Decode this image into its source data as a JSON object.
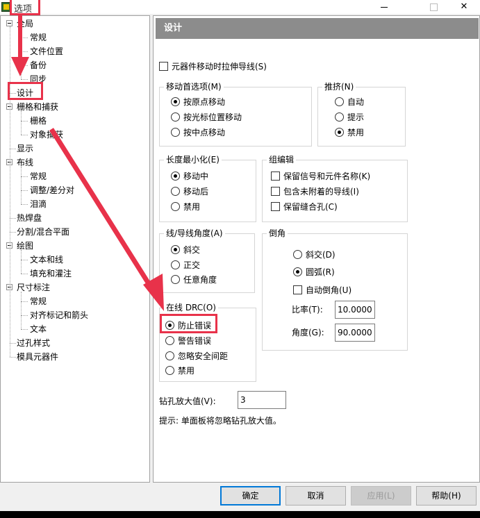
{
  "window": {
    "title": "选项"
  },
  "tree": [
    {
      "label": "全局",
      "level": 0,
      "expandable": true
    },
    {
      "label": "常规",
      "level": 1
    },
    {
      "label": "文件位置",
      "level": 1
    },
    {
      "label": "备份",
      "level": 1
    },
    {
      "label": "同步",
      "level": 1
    },
    {
      "label": "设计",
      "level": 0,
      "selected": true
    },
    {
      "label": "栅格和捕获",
      "level": 0,
      "expandable": true
    },
    {
      "label": "栅格",
      "level": 1
    },
    {
      "label": "对象捕获",
      "level": 1
    },
    {
      "label": "显示",
      "level": 0
    },
    {
      "label": "布线",
      "level": 0,
      "expandable": true
    },
    {
      "label": "常规",
      "level": 1
    },
    {
      "label": "调整/差分对",
      "level": 1
    },
    {
      "label": "泪滴",
      "level": 1
    },
    {
      "label": "热焊盘",
      "level": 0
    },
    {
      "label": "分割/混合平面",
      "level": 0
    },
    {
      "label": "绘图",
      "level": 0,
      "expandable": true
    },
    {
      "label": "文本和线",
      "level": 1
    },
    {
      "label": "填充和灌注",
      "level": 1
    },
    {
      "label": "尺寸标注",
      "level": 0,
      "expandable": true
    },
    {
      "label": "常规",
      "level": 1
    },
    {
      "label": "对齐标记和箭头",
      "level": 1
    },
    {
      "label": "文本",
      "level": 1
    },
    {
      "label": "过孔样式",
      "level": 0
    },
    {
      "label": "模具元器件",
      "level": 0
    }
  ],
  "panel": {
    "header": "设计",
    "stretch_traces": "元器件移动时拉伸导线(S)",
    "move_pref": {
      "title": "移动首选项(M)",
      "options": [
        "按原点移动",
        "按光标位置移动",
        "按中点移动"
      ],
      "selected": 0
    },
    "push": {
      "title": "推挤(N)",
      "options": [
        "自动",
        "提示",
        "禁用"
      ],
      "selected": 2
    },
    "length_min": {
      "title": "长度最小化(E)",
      "options": [
        "移动中",
        "移动后",
        "禁用"
      ],
      "selected": 0
    },
    "group_edit": {
      "title": "组编辑",
      "options": [
        "保留信号和元件名称(K)",
        "包含未附着的导线(I)",
        "保留缝合孔(C)"
      ]
    },
    "line_angle": {
      "title": "线/导线角度(A)",
      "options": [
        "斜交",
        "正交",
        "任意角度"
      ],
      "selected": 0
    },
    "chamfer": {
      "title": "倒角",
      "options": [
        "斜交(D)",
        "圆弧(R)"
      ],
      "selected": 1,
      "auto_label": "自动倒角(U)",
      "ratio_label": "比率(T):",
      "ratio_value": "10.0000",
      "angle_label": "角度(G):",
      "angle_value": "90.0000"
    },
    "online_drc": {
      "title": "在线 DRC(O)",
      "options": [
        "防止错误",
        "警告错误",
        "忽略安全间距",
        "禁用"
      ],
      "selected": 0
    },
    "drill_label": "钻孔放大值(V):",
    "drill_value": "3",
    "hint": "提示:  单面板将忽略钻孔放大值。"
  },
  "buttons": {
    "ok": "确定",
    "cancel": "取消",
    "apply": "应用(L)",
    "help": "帮助(H)"
  },
  "colors": {
    "annotation": "#e8324a",
    "header_bg": "#8c8c8c",
    "ok_border": "#0078d7"
  }
}
